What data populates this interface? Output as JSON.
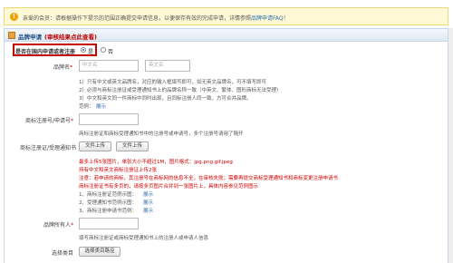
{
  "notice": {
    "text": "亲爱的会员：请根据操作下提示的范围正确提交申请信息，以便保存有效的完成申请，详情参照",
    "link": "品牌申请FAQ",
    "tail": "！"
  },
  "panel": {
    "title": "品牌申请",
    "subtitle": "(审核结果点此查看)"
  },
  "domestic": {
    "label": "是否在国内申请或者注册",
    "yes": "是",
    "no": "否"
  },
  "brand_name": {
    "label": "品牌名",
    "cn_placeholder": "中文名",
    "en_placeholder": "英文名",
    "hint1": "1）只有中文或英文品牌名，对应的输入框填写即可，如无英文品牌名，可不填写即可",
    "hint2": "2）必须与商标注册证或受理通知书上的品牌名称一致（中英文、繁体、图形商标无法受理）",
    "hint3": "3）中文和英文同一件商标中同时出现，且同标注册人同一致，方可合并品牌。",
    "example_label": "范例：",
    "example_link": "展示"
  },
  "reg_no": {
    "label": "商标注册号/申请号",
    "hint": "商标注册证和商标受理通知书中的注册号或申请号，多个注册号请用了隔开"
  },
  "cert": {
    "label": "商标注册证/受理通知书",
    "btn1": "文件上传",
    "btn2": "文件上传",
    "hint_red1": "最多上传5张图片，单张大小不超过1M，图片格式：jpg.png.gif.jpeg",
    "hint_red2": "持有中文和英文商标注册证上传2张",
    "hint_red3": "注意：若申请的商标，其注册号在商标网的信息不全，在审核失败；需要再提交商标受理通知书和商标变更注册申请书",
    "hint_red4": "商标注册证书有多页的，请按多页图片合并到一张图片上，具体内容参见范例图示",
    "ex1_label": "1、商标注册证范例示图：",
    "ex1_link": "展示",
    "ex2_label": "2、受理通知书范例示图：",
    "ex2_link": "展示",
    "ex3_label": "3、商标注册申请书范例：",
    "ex3_link": "展示"
  },
  "owner": {
    "label": "品牌所有人",
    "hint": "填写商标注册证或商标受理通知书上的注册人或申请人信息"
  },
  "category": {
    "label": "选择类目",
    "btn": "选择类目路径"
  }
}
